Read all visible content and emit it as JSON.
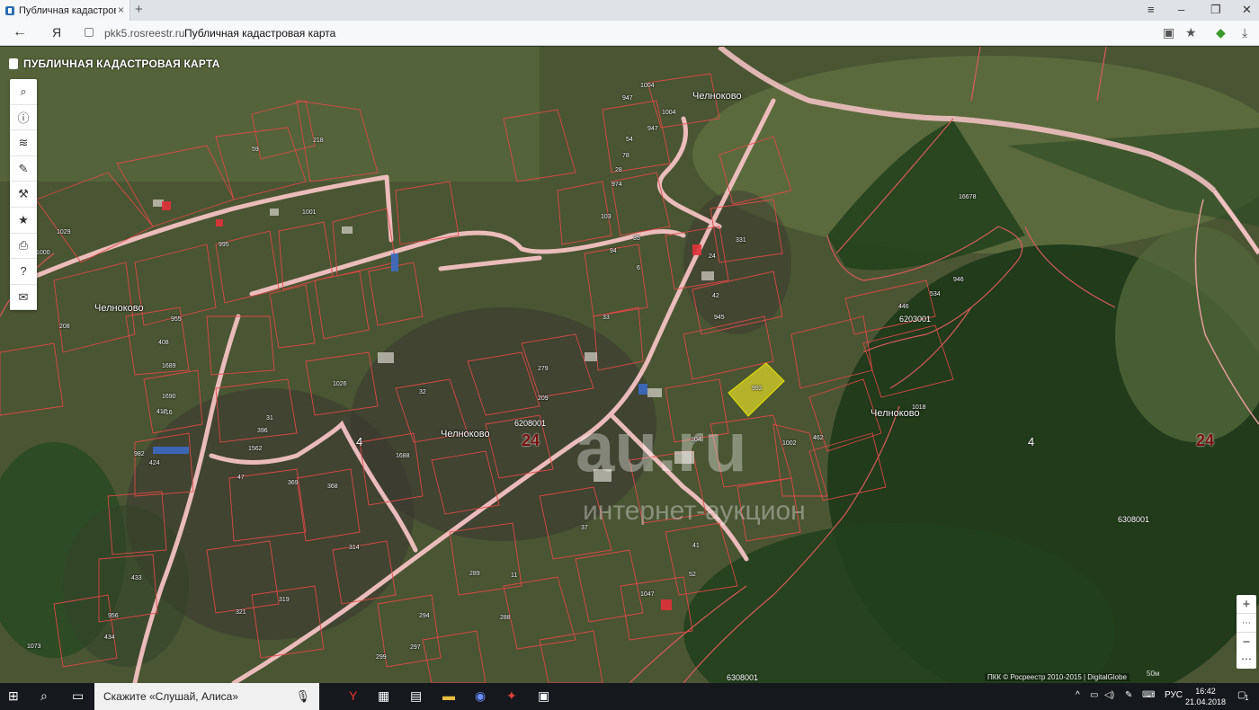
{
  "browser": {
    "tab_title": "Публичная кадастровая",
    "tab_close": "×",
    "new_tab": "+",
    "back": "←",
    "ya_button": "Я",
    "domain": "pkk5.rosreestr.ru",
    "page_title": "Публичная кадастровая карта",
    "menu": "≡",
    "minimize": "–",
    "restore": "❐",
    "close": "✕",
    "bookmark": "★",
    "download": "⤓"
  },
  "map": {
    "title": "ПУБЛИЧНАЯ КАДАСТРОВАЯ КАРТА",
    "tools": [
      "search-icon",
      "info-icon",
      "layers-icon",
      "pencil-icon",
      "measure-icon",
      "star-icon",
      "print-icon",
      "help-icon",
      "mail-icon"
    ],
    "tool_glyphs": [
      "⌕",
      "ⓘ",
      "≋",
      "✎",
      "⚒",
      "★",
      "⎙",
      "?",
      "✉"
    ],
    "zoom_in": "+",
    "zoom_mid": "⋯",
    "zoom_out": "−",
    "zoom_extra": "⋯",
    "attribution": "ПКК © Росреестр 2010-2015 | DigitalGlobe",
    "scale": "50м",
    "selected_parcel": "992",
    "places": [
      {
        "text": "Челноково"
      },
      {
        "text": "Челноково"
      },
      {
        "text": "Челноково"
      },
      {
        "text": "Челноково"
      }
    ],
    "quarter_numbers": [
      "24",
      "24",
      "24"
    ],
    "fours": [
      "4",
      "4"
    ],
    "codes": [
      "6208001",
      "6203001",
      "6308001",
      "6308001"
    ],
    "parcel_numbers": [
      "1004",
      "947",
      "1004",
      "947",
      "54",
      "78",
      "28",
      "974",
      "103",
      "35",
      "331",
      "218",
      "59",
      "1001",
      "995",
      "1029",
      "1000",
      "208",
      "955",
      "408",
      "1689",
      "1690",
      "416",
      "417",
      "982",
      "424",
      "47",
      "369",
      "368",
      "314",
      "319",
      "321",
      "433",
      "956",
      "434",
      "1073",
      "1026",
      "32",
      "279",
      "209",
      "104",
      "946",
      "534",
      "446",
      "1002",
      "462",
      "41",
      "52",
      "1047",
      "288",
      "297",
      "299",
      "294",
      "11",
      "289",
      "37",
      "16678",
      "1562",
      "396",
      "31",
      "1018",
      "1688",
      "94",
      "33",
      "6",
      "42",
      "945",
      "24"
    ],
    "watermark_main": "au.ru",
    "watermark_sub": "интернет-аукцион"
  },
  "taskbar": {
    "search_placeholder": "Скажите «Слушай, Алиса»",
    "lang": "РУС",
    "time": "16:42",
    "date": "21.04.2018",
    "notif": "1"
  }
}
